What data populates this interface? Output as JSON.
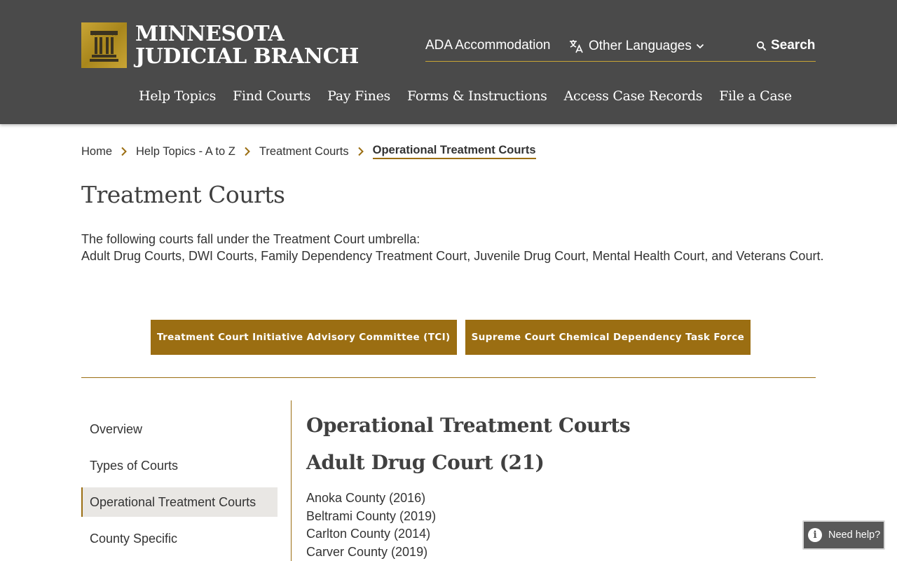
{
  "header": {
    "logo_line1": "MINNESOTA",
    "logo_line2": "JUDICIAL BRANCH",
    "util": {
      "ada": "ADA Accommodation",
      "languages": "Other Languages",
      "search": "Search"
    },
    "nav": [
      {
        "label": "Help Topics"
      },
      {
        "label": "Find Courts"
      },
      {
        "label": "Pay Fines"
      },
      {
        "label": "Forms & Instructions"
      },
      {
        "label": "Access Case Records"
      },
      {
        "label": "File a Case"
      }
    ]
  },
  "breadcrumb": {
    "items": [
      "Home",
      "Help Topics - A to Z",
      "Treatment Courts"
    ],
    "current": "Operational Treatment Courts"
  },
  "page_title": "Treatment Courts",
  "intro": {
    "line1": "The following courts fall under the Treatment Court umbrella:",
    "line2": "Adult Drug Courts, DWI Courts, Family Dependency Treatment Court, Juvenile Drug Court, Mental Health Court, and Veterans Court."
  },
  "buttons": [
    {
      "label": "Treatment Court Initiative Advisory Committee (TCI)"
    },
    {
      "label": "Supreme Court Chemical Dependency Task Force"
    }
  ],
  "sidebar": {
    "items": [
      {
        "label": "Overview"
      },
      {
        "label": "Types of Courts"
      },
      {
        "label": "Operational Treatment Courts"
      },
      {
        "label": "County Specific"
      }
    ]
  },
  "content": {
    "heading": "Operational Treatment Courts",
    "subheading": "Adult Drug Court (21)",
    "counties": [
      "Anoka County (2016)",
      "Beltrami County (2019)",
      "Carlton County (2014)",
      "Carver County (2019)"
    ]
  },
  "help_widget": {
    "label": "Need help?"
  },
  "colors": {
    "header_bg": "#4a4a4a",
    "accent": "#9b6e12",
    "gold": "#c9a535"
  }
}
